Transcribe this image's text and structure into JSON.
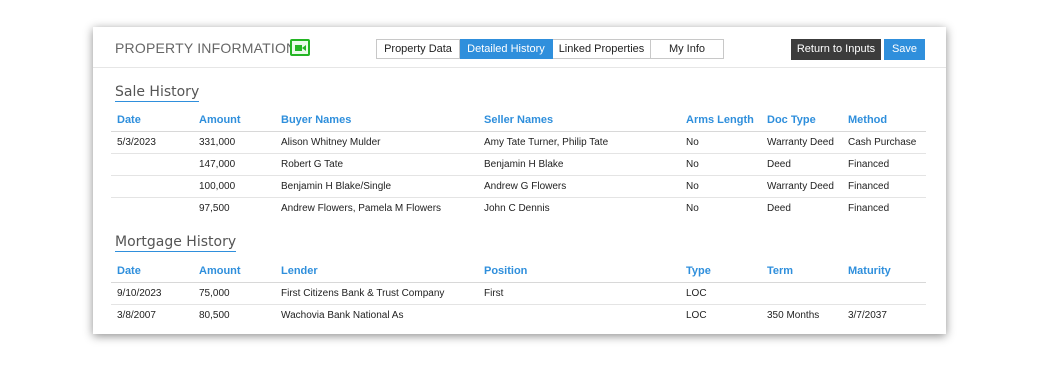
{
  "header": {
    "title": "PROPERTY INFORMATION",
    "video_icon": "video-camera-icon",
    "tabs": [
      {
        "label": "Property Data",
        "active": false
      },
      {
        "label": "Detailed History",
        "active": true
      },
      {
        "label": "Linked Properties",
        "active": false
      },
      {
        "label": "My Info",
        "active": false
      }
    ],
    "return_label": "Return to Inputs",
    "save_label": "Save"
  },
  "colors": {
    "accent": "#2f8fdc",
    "dark_button": "#3c3c3c",
    "video_green": "#23b523"
  },
  "sale_history": {
    "title": "Sale History",
    "columns": [
      "Date",
      "Amount",
      "Buyer Names",
      "Seller Names",
      "Arms Length",
      "Doc Type",
      "Method"
    ],
    "rows": [
      [
        "5/3/2023",
        "331,000",
        "Alison Whitney Mulder",
        "Amy Tate Turner, Philip Tate",
        "No",
        "Warranty Deed",
        "Cash Purchase"
      ],
      [
        "",
        "147,000",
        "Robert G Tate",
        "Benjamin H Blake",
        "No",
        "Deed",
        "Financed"
      ],
      [
        "",
        "100,000",
        "Benjamin H Blake/Single",
        "Andrew G Flowers",
        "No",
        "Warranty Deed",
        "Financed"
      ],
      [
        "",
        "97,500",
        "Andrew Flowers, Pamela M Flowers",
        "John C Dennis",
        "No",
        "Deed",
        "Financed"
      ]
    ]
  },
  "mortgage_history": {
    "title": "Mortgage History",
    "columns": [
      "Date",
      "Amount",
      "Lender",
      "Position",
      "Type",
      "Term",
      "Maturity"
    ],
    "rows": [
      [
        "9/10/2023",
        "75,000",
        "First Citizens Bank & Trust Company",
        "First",
        "LOC",
        "",
        ""
      ],
      [
        "3/8/2007",
        "80,500",
        "Wachovia Bank National As",
        "",
        "LOC",
        "350 Months",
        "3/7/2037"
      ]
    ]
  }
}
